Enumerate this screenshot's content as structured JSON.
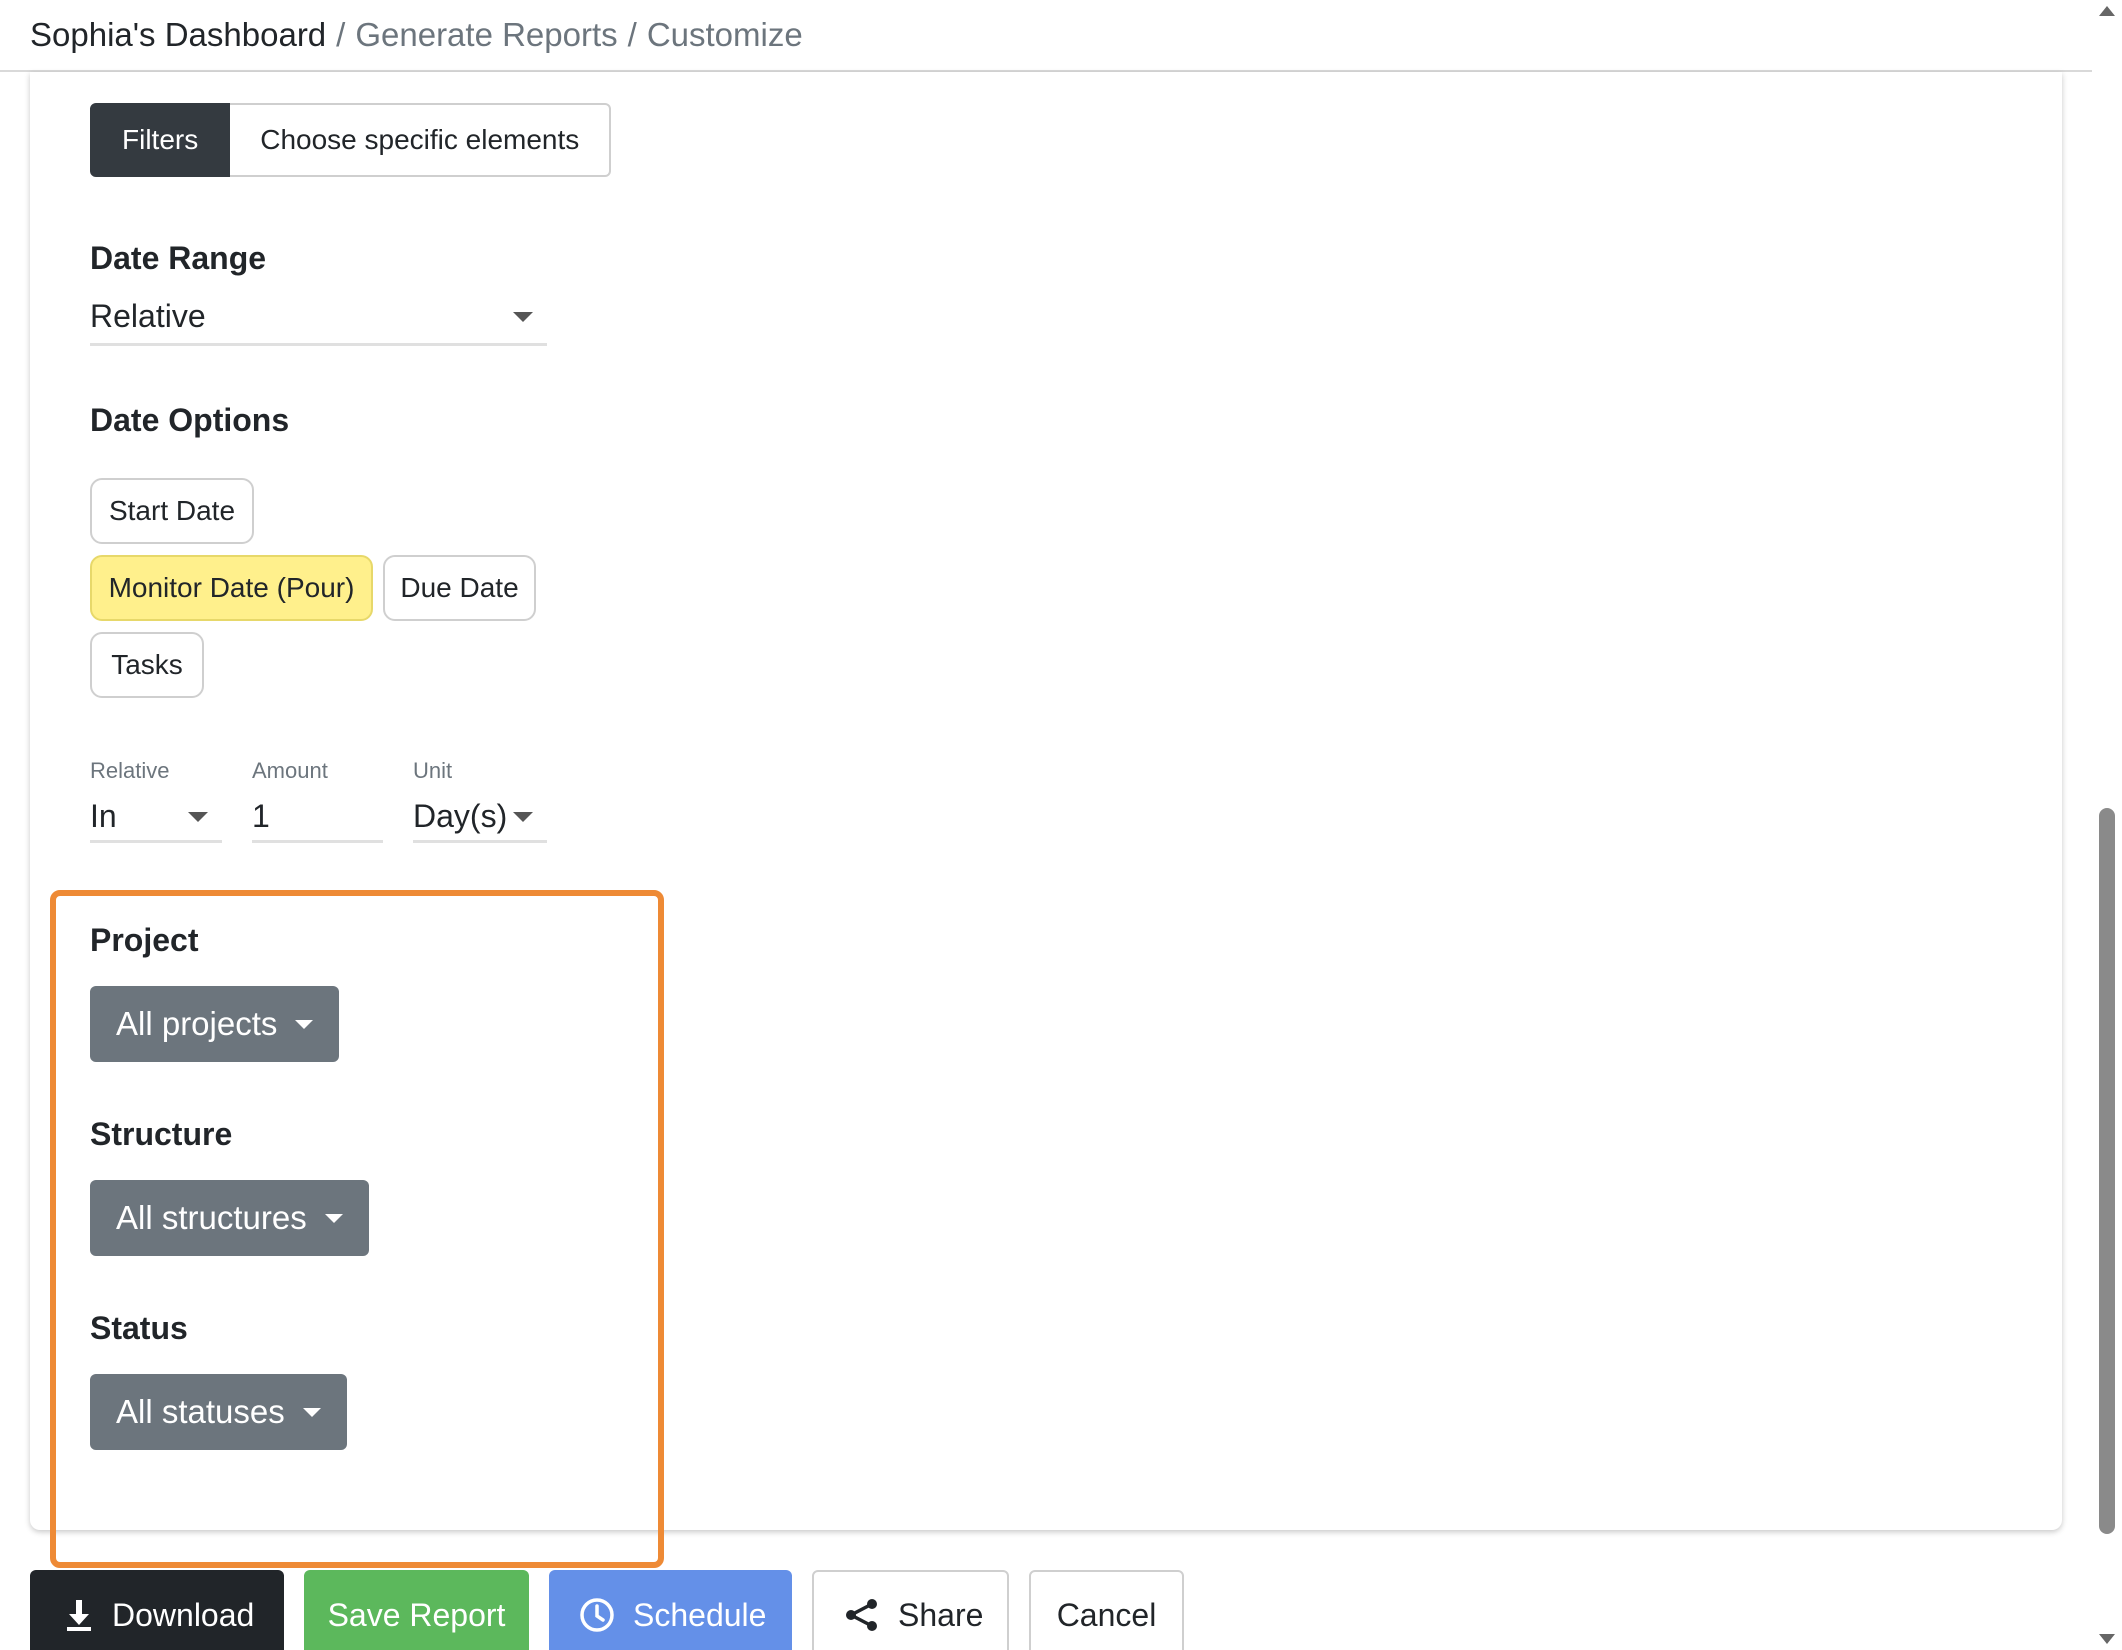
{
  "breadcrumb": {
    "items": [
      "Sophia's Dashboard",
      "Generate Reports",
      "Customize"
    ],
    "separator": "/"
  },
  "toggle": {
    "filters_label": "Filters",
    "elements_label": "Choose specific elements",
    "active": "Filters"
  },
  "date_range": {
    "label": "Date Range",
    "value": "Relative"
  },
  "date_options": {
    "label": "Date Options",
    "chips": [
      "Start Date",
      "Monitor Date (Pour)",
      "Due Date",
      "Tasks"
    ],
    "selected": "Monitor Date (Pour)"
  },
  "relative_fields": {
    "relative_label": "Relative",
    "relative_value": "In",
    "amount_label": "Amount",
    "amount_value": "1",
    "unit_label": "Unit",
    "unit_value": "Day(s)"
  },
  "filters": {
    "project_label": "Project",
    "project_value": "All projects",
    "structure_label": "Structure",
    "structure_value": "All structures",
    "status_label": "Status",
    "status_value": "All statuses"
  },
  "actions": {
    "download": "Download",
    "save": "Save Report",
    "schedule": "Schedule",
    "share": "Share",
    "cancel": "Cancel"
  },
  "colors": {
    "highlight_border": "#ee8a35",
    "selected_chip": "#fff08c",
    "dropdown_bg": "#6c757d",
    "save_green": "#5cb85c",
    "schedule_blue": "#6490e8"
  }
}
